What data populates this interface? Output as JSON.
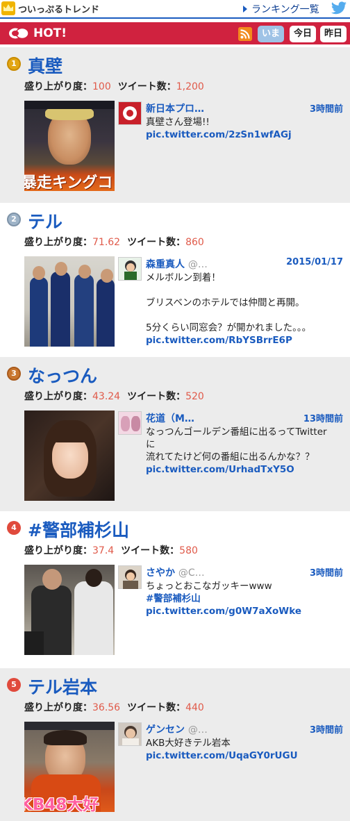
{
  "header": {
    "logo_text": "ついっぷるトレンド",
    "ranking_link": "ランキング一覧"
  },
  "hotbar": {
    "title": "HOT!",
    "tabs": [
      "いま",
      "今日",
      "昨日"
    ]
  },
  "labels": {
    "excitement": "盛り上がり度：",
    "tweets": "ツイート数："
  },
  "colors": {
    "brand_red": "#d0223f",
    "link_blue": "#1a5bbf",
    "number_red": "#e05a4a",
    "item_bg": "#ececec"
  },
  "items": [
    {
      "rank": "1",
      "term": "真壁",
      "excitement": "100",
      "tweets": "1,200",
      "user": "新日本プロ…",
      "handle": "",
      "time": "3時間前",
      "lines": [
        "真壁さん登場!!"
      ],
      "link": "pic.twitter.com/2zSn1wfAGj",
      "photo_caption": "暴走キングコン"
    },
    {
      "rank": "2",
      "term": "テル",
      "excitement": "71.62",
      "tweets": "860",
      "user": "森重真人",
      "handle": "@…",
      "time": "2015/01/17",
      "lines": [
        "メルボルン到着！",
        "",
        "ブリスベンのホテルでは仲間と再開。",
        "",
        "5分くらい同窓会？が開かれました。。。"
      ],
      "link": "pic.twitter.com/RbYSBrrE6P",
      "photo_caption": ""
    },
    {
      "rank": "3",
      "term": "なっつん",
      "excitement": "43.24",
      "tweets": "520",
      "user": "花道（M…",
      "handle": "",
      "time": "13時間前",
      "lines": [
        "なっつんゴールデン番組に出るってTwitter",
        "に",
        "流れてたけど何の番組に出るんかな？？"
      ],
      "link": "pic.twitter.com/UrhadTxY5O",
      "photo_caption": ""
    },
    {
      "rank": "4",
      "term": "#警部補杉山",
      "excitement": "37.4",
      "tweets": "580",
      "user": "さやか",
      "handle": "@C…",
      "time": "3時間前",
      "lines": [
        "ちょっとおこなガッキーwww"
      ],
      "hashtag": "#警部補杉山",
      "link": "pic.twitter.com/g0W7aXoWke",
      "photo_caption": ""
    },
    {
      "rank": "5",
      "term": "テル岩本",
      "excitement": "36.56",
      "tweets": "440",
      "user": "ゲンセン",
      "handle": "@…",
      "time": "3時間前",
      "lines": [
        "AKB大好きテル岩本"
      ],
      "link": "pic.twitter.com/UqaGY0rUGU",
      "photo_caption": "KB48大好"
    }
  ]
}
